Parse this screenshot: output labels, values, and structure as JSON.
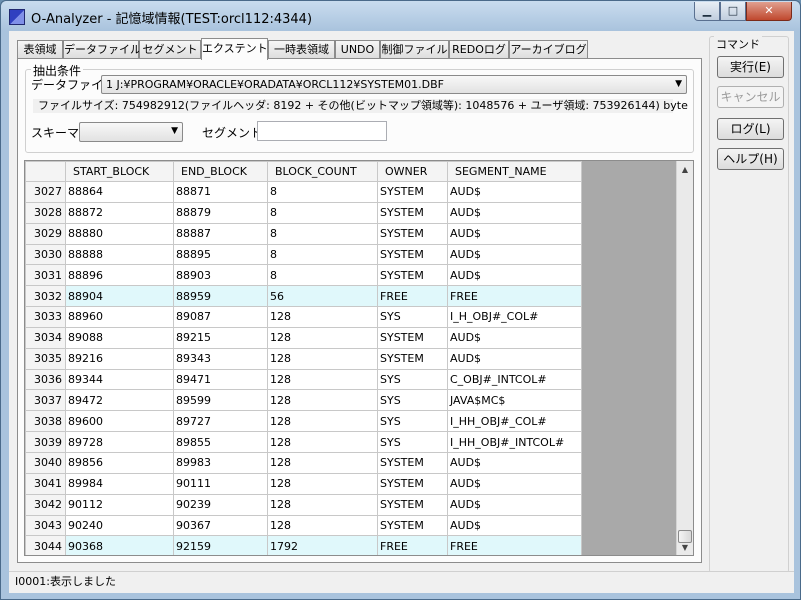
{
  "window": {
    "title": "O-Analyzer - 記憶域情報(TEST:orcl112:4344)",
    "min_glyph": "▁",
    "max_glyph": "□",
    "close_glyph": "✕"
  },
  "tabs": [
    {
      "label": "表領域"
    },
    {
      "label": "データファイル"
    },
    {
      "label": "セグメント"
    },
    {
      "label": "エクステント",
      "active": true
    },
    {
      "label": "一時表領域"
    },
    {
      "label": "UNDO"
    },
    {
      "label": "制御ファイル"
    },
    {
      "label": "REDOログ"
    },
    {
      "label": "アーカイブログ"
    }
  ],
  "filter": {
    "title": "抽出条件",
    "datafile_label": "データファイル",
    "datafile_value": "1 J:¥PROGRAM¥ORACLE¥ORADATA¥ORCL112¥SYSTEM01.DBF",
    "size_info": "ファイルサイズ: 754982912(ファイルヘッダ: 8192 + その他(ビットマップ領域等): 1048576 + ユーザ領域: 753926144) byte",
    "schema_label": "スキーマ",
    "schema_value": "",
    "segment_label": "セグメント",
    "segment_value": ""
  },
  "grid": {
    "columns": [
      "START_BLOCK",
      "END_BLOCK",
      "BLOCK_COUNT",
      "OWNER",
      "SEGMENT_NAME"
    ],
    "rows": [
      {
        "n": "3027",
        "cells": [
          "88864",
          "88871",
          "8",
          "SYSTEM",
          "AUD$"
        ]
      },
      {
        "n": "3028",
        "cells": [
          "88872",
          "88879",
          "8",
          "SYSTEM",
          "AUD$"
        ]
      },
      {
        "n": "3029",
        "cells": [
          "88880",
          "88887",
          "8",
          "SYSTEM",
          "AUD$"
        ]
      },
      {
        "n": "3030",
        "cells": [
          "88888",
          "88895",
          "8",
          "SYSTEM",
          "AUD$"
        ]
      },
      {
        "n": "3031",
        "cells": [
          "88896",
          "88903",
          "8",
          "SYSTEM",
          "AUD$"
        ]
      },
      {
        "n": "3032",
        "cells": [
          "88904",
          "88959",
          "56",
          "FREE",
          "FREE"
        ],
        "free": true
      },
      {
        "n": "3033",
        "cells": [
          "88960",
          "89087",
          "128",
          "SYS",
          "I_H_OBJ#_COL#"
        ]
      },
      {
        "n": "3034",
        "cells": [
          "89088",
          "89215",
          "128",
          "SYSTEM",
          "AUD$"
        ]
      },
      {
        "n": "3035",
        "cells": [
          "89216",
          "89343",
          "128",
          "SYSTEM",
          "AUD$"
        ]
      },
      {
        "n": "3036",
        "cells": [
          "89344",
          "89471",
          "128",
          "SYS",
          "C_OBJ#_INTCOL#"
        ]
      },
      {
        "n": "3037",
        "cells": [
          "89472",
          "89599",
          "128",
          "SYS",
          "JAVA$MC$"
        ]
      },
      {
        "n": "3038",
        "cells": [
          "89600",
          "89727",
          "128",
          "SYS",
          "I_HH_OBJ#_COL#"
        ]
      },
      {
        "n": "3039",
        "cells": [
          "89728",
          "89855",
          "128",
          "SYS",
          "I_HH_OBJ#_INTCOL#"
        ]
      },
      {
        "n": "3040",
        "cells": [
          "89856",
          "89983",
          "128",
          "SYSTEM",
          "AUD$"
        ]
      },
      {
        "n": "3041",
        "cells": [
          "89984",
          "90111",
          "128",
          "SYSTEM",
          "AUD$"
        ]
      },
      {
        "n": "3042",
        "cells": [
          "90112",
          "90239",
          "128",
          "SYSTEM",
          "AUD$"
        ]
      },
      {
        "n": "3043",
        "cells": [
          "90240",
          "90367",
          "128",
          "SYSTEM",
          "AUD$"
        ]
      },
      {
        "n": "3044",
        "cells": [
          "90368",
          "92159",
          "1792",
          "FREE",
          "FREE"
        ],
        "free": true
      }
    ]
  },
  "commands": {
    "title": "コマンド",
    "execute": "実行(E)",
    "cancel": "キャンセル",
    "log": "ログ(L)",
    "help": "ヘルプ(H)"
  },
  "status": {
    "text": "I0001:表示しました"
  }
}
